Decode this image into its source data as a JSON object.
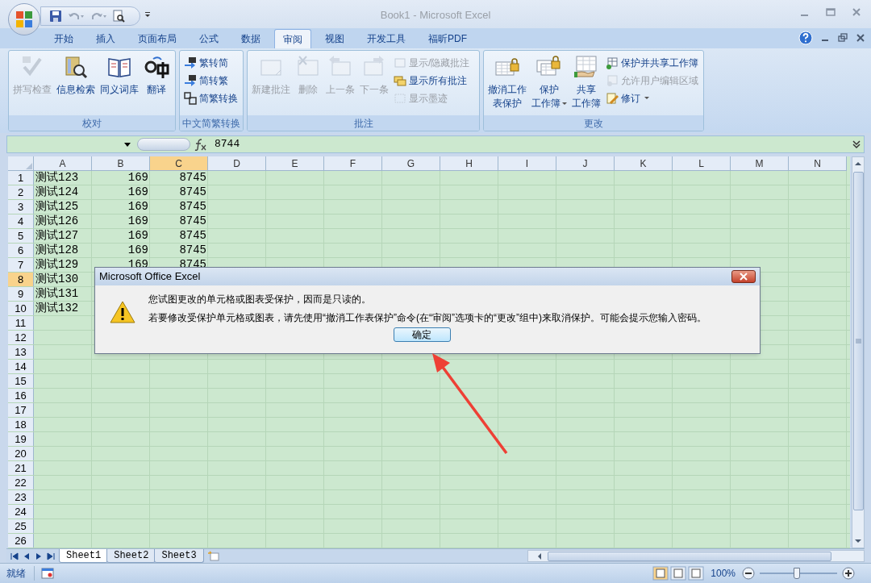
{
  "window": {
    "title": "Book1 - Microsoft Excel"
  },
  "tabs": [
    {
      "label": "开始",
      "selected": false
    },
    {
      "label": "插入",
      "selected": false
    },
    {
      "label": "页面布局",
      "selected": false
    },
    {
      "label": "公式",
      "selected": false
    },
    {
      "label": "数据",
      "selected": false
    },
    {
      "label": "审阅",
      "selected": true
    },
    {
      "label": "视图",
      "selected": false
    },
    {
      "label": "开发工具",
      "selected": false
    },
    {
      "label": "福昕PDF",
      "selected": false
    }
  ],
  "ribbon": {
    "groups": [
      {
        "title": "校对",
        "items": [
          {
            "kind": "large",
            "label": "拼写检查",
            "disabled": true
          },
          {
            "kind": "large",
            "label": "信息检索",
            "disabled": false
          },
          {
            "kind": "large",
            "label": "同义词库",
            "disabled": false
          },
          {
            "kind": "large",
            "label": "翻译",
            "disabled": false
          }
        ]
      },
      {
        "title": "中文简繁转换",
        "items": [
          {
            "kind": "small",
            "label": "繁转简",
            "disabled": false
          },
          {
            "kind": "small",
            "label": "简转繁",
            "disabled": false
          },
          {
            "kind": "small",
            "label": "简繁转换",
            "disabled": false
          }
        ]
      },
      {
        "title": "批注",
        "items": [
          {
            "kind": "large",
            "label": "新建批注",
            "disabled": true
          },
          {
            "kind": "large",
            "label": "删除",
            "disabled": true
          },
          {
            "kind": "large",
            "label": "上一条",
            "disabled": true
          },
          {
            "kind": "large",
            "label": "下一条",
            "disabled": true
          },
          {
            "kind": "small",
            "label": "显示/隐藏批注",
            "disabled": true
          },
          {
            "kind": "small",
            "label": "显示所有批注",
            "disabled": false
          },
          {
            "kind": "small",
            "label": "显示墨迹",
            "disabled": true
          }
        ]
      },
      {
        "title": "更改",
        "items": [
          {
            "kind": "large",
            "label_lines": [
              "撤消工作",
              "表保护"
            ],
            "disabled": false
          },
          {
            "kind": "large",
            "label_lines": [
              "保护",
              "工作簿"
            ],
            "disabled": false,
            "dropdown": true
          },
          {
            "kind": "large",
            "label_lines": [
              "共享",
              "工作簿"
            ],
            "disabled": false
          },
          {
            "kind": "small",
            "label": "保护并共享工作簿",
            "disabled": false
          },
          {
            "kind": "small",
            "label": "允许用户编辑区域",
            "disabled": true
          },
          {
            "kind": "small",
            "label": "修订",
            "disabled": false,
            "dropdown": true
          }
        ]
      }
    ]
  },
  "formula_bar": {
    "value": "8744"
  },
  "sheet": {
    "columns": [
      {
        "label": "A",
        "selected": false
      },
      {
        "label": "B",
        "selected": false
      },
      {
        "label": "C",
        "selected": true
      },
      {
        "label": "D",
        "selected": false
      },
      {
        "label": "E",
        "selected": false
      },
      {
        "label": "F",
        "selected": false
      },
      {
        "label": "G",
        "selected": false
      },
      {
        "label": "H",
        "selected": false
      },
      {
        "label": "I",
        "selected": false
      },
      {
        "label": "J",
        "selected": false
      },
      {
        "label": "K",
        "selected": false
      },
      {
        "label": "L",
        "selected": false
      },
      {
        "label": "M",
        "selected": false
      },
      {
        "label": "N",
        "selected": false
      }
    ],
    "rows": [
      {
        "label": "1",
        "selected": false,
        "cells": [
          "测试123",
          "169",
          "8745"
        ]
      },
      {
        "label": "2",
        "selected": false,
        "cells": [
          "测试124",
          "169",
          "8745"
        ]
      },
      {
        "label": "3",
        "selected": false,
        "cells": [
          "测试125",
          "169",
          "8745"
        ]
      },
      {
        "label": "4",
        "selected": false,
        "cells": [
          "测试126",
          "169",
          "8745"
        ]
      },
      {
        "label": "5",
        "selected": false,
        "cells": [
          "测试127",
          "169",
          "8745"
        ]
      },
      {
        "label": "6",
        "selected": false,
        "cells": [
          "测试128",
          "169",
          "8745"
        ]
      },
      {
        "label": "7",
        "selected": false,
        "cells": [
          "测试129",
          "169",
          "8745"
        ]
      },
      {
        "label": "8",
        "selected": true,
        "cells": [
          "测试130"
        ]
      },
      {
        "label": "9",
        "selected": false,
        "cells": [
          "测试131"
        ]
      },
      {
        "label": "10",
        "selected": false,
        "cells": [
          "测试132"
        ]
      },
      {
        "label": "11",
        "selected": false
      },
      {
        "label": "12",
        "selected": false
      },
      {
        "label": "13",
        "selected": false
      },
      {
        "label": "14",
        "selected": false
      },
      {
        "label": "15",
        "selected": false
      },
      {
        "label": "16",
        "selected": false
      },
      {
        "label": "17",
        "selected": false
      },
      {
        "label": "18",
        "selected": false
      },
      {
        "label": "19",
        "selected": false
      },
      {
        "label": "20",
        "selected": false
      },
      {
        "label": "21",
        "selected": false
      },
      {
        "label": "22",
        "selected": false
      },
      {
        "label": "23",
        "selected": false
      },
      {
        "label": "24",
        "selected": false
      },
      {
        "label": "25",
        "selected": false
      },
      {
        "label": "26",
        "selected": false
      }
    ]
  },
  "dialog": {
    "title": "Microsoft Office Excel",
    "messages": [
      "您试图更改的单元格或图表受保护，因而是只读的。",
      "若要修改受保护单元格或图表，请先使用“撤消工作表保护”命令(在“审阅”选项卡的“更改”组中)来取消保护。可能会提示您输入密码。"
    ],
    "button": "确定"
  },
  "sheet_tabs": [
    {
      "label": "Sheet1",
      "selected": true
    },
    {
      "label": "Sheet2",
      "selected": false
    },
    {
      "label": "Sheet3",
      "selected": false
    }
  ],
  "status_bar": {
    "status": "就绪",
    "zoom": "100%",
    "zoom_slider": {
      "level": 0.48
    }
  }
}
